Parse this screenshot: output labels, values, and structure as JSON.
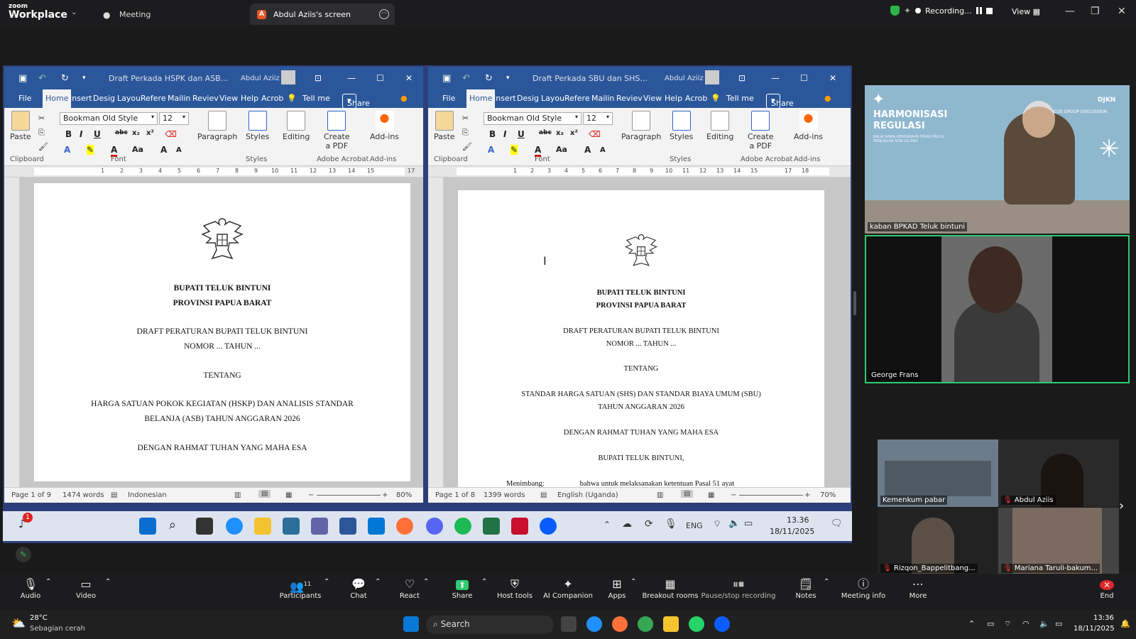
{
  "zoom": {
    "brand_small": "zoom",
    "brand": "Workplace",
    "tab_meeting": "Meeting",
    "tab_screen": "Abdul Aziis's screen",
    "tab_screen_initial": "A",
    "recording": "Recording...",
    "view": "View"
  },
  "left_doc": {
    "title": "Draft Perkada HSPK dan ASB...",
    "user": "Abdul Aziiz",
    "tabs": [
      "File",
      "Home",
      "Insert",
      "Desig",
      "Layou",
      "Refere",
      "Mailin",
      "Reviev",
      "View",
      "Help",
      "Acrob"
    ],
    "tell_me": "Tell me",
    "share": "Share",
    "font_name": "Bookman Old Style",
    "font_size": "12",
    "groups": {
      "clipboard": "Clipboard",
      "font": "Font",
      "styles": "Styles",
      "adobe": "Adobe Acrobat",
      "addins": "Add-ins"
    },
    "buttons": {
      "paste": "Paste",
      "paragraph": "Paragraph",
      "styles": "Styles",
      "editing": "Editing",
      "create_pdf_1": "Create",
      "create_pdf_2": "a PDF",
      "addins": "Add-ins"
    },
    "ruler_labels": [
      "1",
      "2",
      "3",
      "4",
      "5",
      "6",
      "7",
      "8",
      "9",
      "10",
      "11",
      "12",
      "13",
      "14",
      "15",
      "17"
    ],
    "lines": [
      "BUPATI TELUK BINTUNI",
      "PROVINSI PAPUA BARAT",
      "DRAFT PERATURAN BUPATI TELUK BINTUNI",
      "NOMOR ... TAHUN ...",
      "TENTANG",
      "HARGA SATUAN POKOK KEGIATAN (HSKP) DAN ANALISIS STANDAR",
      "BELANJA (ASB) TAHUN ANGGARAN 2026",
      "DENGAN RAHMAT TUHAN YANG MAHA ESA"
    ],
    "status": {
      "page": "Page 1 of 9",
      "words": "1474 words",
      "lang": "Indonesian",
      "zoom": "80%"
    }
  },
  "right_doc": {
    "title": "Draft Perkada SBU dan SHS...",
    "user": "Abdul Aziiz",
    "tabs": [
      "File",
      "Home",
      "Insert",
      "Desig",
      "Layou",
      "Refere",
      "Mailin",
      "Reviev",
      "View",
      "Help",
      "Acrob"
    ],
    "tell_me": "Tell me",
    "share": "Share",
    "font_name": "Bookman Old Style",
    "font_size": "12",
    "groups": {
      "clipboard": "Clipboard",
      "font": "Font",
      "styles": "Styles",
      "adobe": "Adobe Acrobat",
      "addins": "Add-ins"
    },
    "buttons": {
      "paste": "Paste",
      "paragraph": "Paragraph",
      "styles": "Styles",
      "editing": "Editing",
      "create_pdf_1": "Create",
      "create_pdf_2": "a PDF",
      "addins": "Add-ins"
    },
    "ruler_labels": [
      "1",
      "2",
      "3",
      "4",
      "5",
      "6",
      "7",
      "8",
      "9",
      "10",
      "11",
      "12",
      "13",
      "14",
      "15",
      "17",
      "18"
    ],
    "lines": [
      "BUPATI TELUK BINTUNI",
      "PROVINSI PAPUA BARAT",
      "DRAFT PERATURAN BUPATI TELUK BINTUNI",
      "NOMOR ... TAHUN ...",
      "TENTANG",
      "STANDAR HARGA SATUAN (SHS) DAN STANDAR BIAYA UMUM (SBU)",
      "TAHUN ANGGARAN 2026",
      "DENGAN RAHMAT TUHAN YANG MAHA ESA",
      "BUPATI TELUK BINTUNI,"
    ],
    "menimbang": "Menimbang:",
    "menimbang_text": "bahwa untuk melaksanakan ketentuan Pasal 51 ayat",
    "status": {
      "page": "Page 1 of 8",
      "words": "1399 words",
      "lang": "English (Uganda)",
      "zoom": "70%"
    }
  },
  "shared_taskbar": {
    "lang": "ENG",
    "time": "13.36",
    "date": "18/11/2025",
    "badge": "1"
  },
  "participants": {
    "top": "kaban BPKAD Teluk bintuni",
    "slide_title_1": "HARMONISASI",
    "slide_title_2": "REGULASI",
    "slide_sub": "BALAI NAMA KENDARAAN DINAS PASCA PENJUALAN NON LELANG",
    "slide_logo": "DJKN",
    "slide_fgd": "FOCUS GROUP DISCUSSION",
    "active": "George Frans",
    "grid": [
      "Kemenkum pabar",
      "Abdul Aziis",
      "Rizqon_Bappelitbang...",
      "Mariana Taruli-bakum..."
    ]
  },
  "controls": {
    "audio": "Audio",
    "video": "Video",
    "participants": "Participants",
    "participants_count": "11",
    "chat": "Chat",
    "react": "React",
    "share": "Share",
    "host_tools": "Host tools",
    "ai": "AI Companion",
    "apps": "Apps",
    "breakout": "Breakout rooms",
    "pause_rec": "Pause/stop recording",
    "notes": "Notes",
    "info": "Meeting info",
    "more": "More",
    "end": "End"
  },
  "windows_taskbar": {
    "temp": "28°C",
    "weather": "Sebagian cerah",
    "search": "Search",
    "time": "13:36",
    "date": "18/11/2025"
  }
}
